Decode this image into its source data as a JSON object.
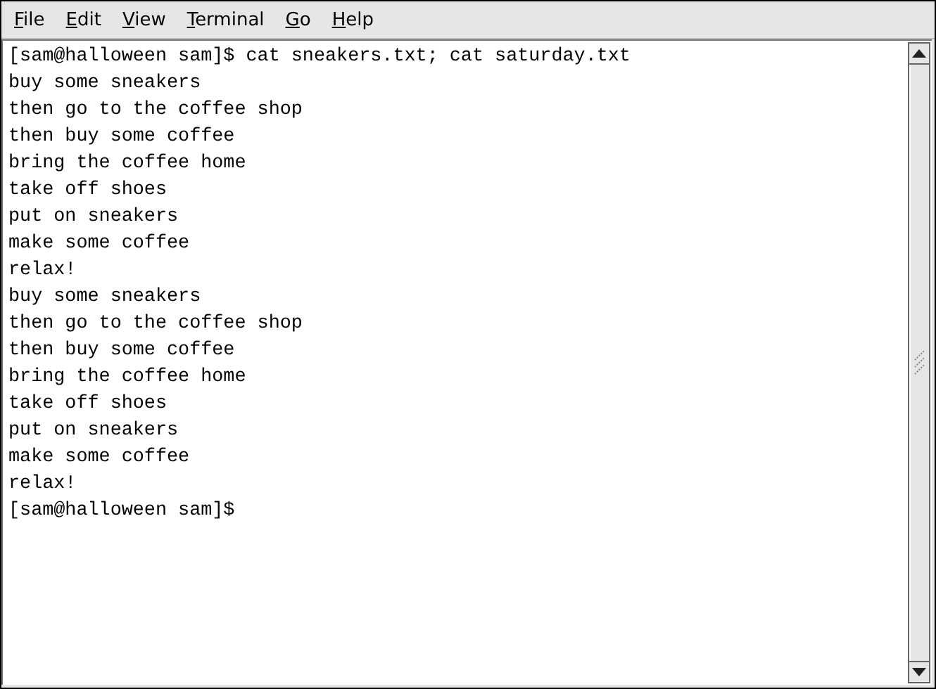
{
  "menu_bar": [
    {
      "label": "File"
    },
    {
      "label": "Edit"
    },
    {
      "label": "View"
    },
    {
      "label": "Terminal"
    },
    {
      "label": "Go"
    },
    {
      "label": "Help"
    }
  ],
  "terminal": {
    "lines": [
      "[sam@halloween sam]$ cat sneakers.txt; cat saturday.txt",
      "buy some sneakers",
      "then go to the coffee shop",
      "then buy some coffee",
      "bring the coffee home",
      "take off shoes",
      "put on sneakers",
      "make some coffee",
      "relax!",
      "buy some sneakers",
      "then go to the coffee shop",
      "then buy some coffee",
      "bring the coffee home",
      "take off shoes",
      "put on sneakers",
      "make some coffee",
      "relax!",
      "[sam@halloween sam]$"
    ]
  }
}
